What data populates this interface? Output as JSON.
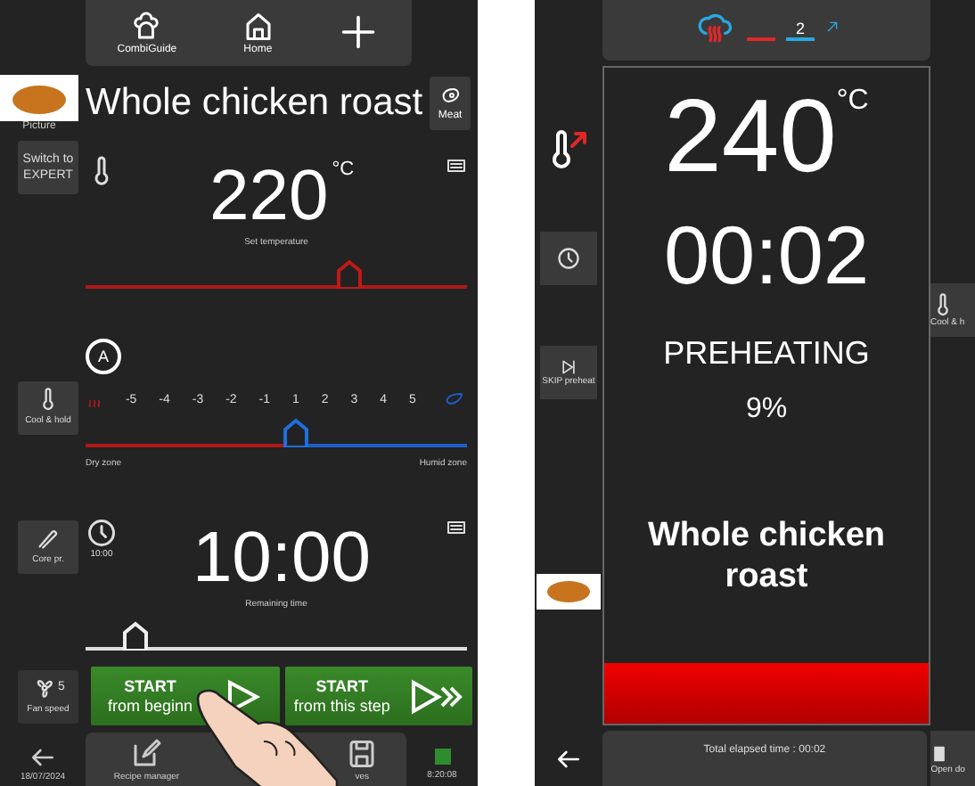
{
  "editor": {
    "top_bar": [
      {
        "kind": "guide",
        "label": "CombiGuide"
      },
      {
        "kind": "home",
        "label": "Home"
      },
      {
        "kind": "add"
      }
    ],
    "picture_label": "Picture",
    "title": "Whole chicken roast",
    "category_label": "Meat",
    "expert_button": "Switch to EXPERT",
    "temperature": {
      "value": "220",
      "unit": "°C",
      "caption": "Set temperature",
      "level": 0.69
    },
    "cool_hold_label": "Cool & hold",
    "humidity": {
      "icon_label": "A",
      "scale": [
        "-5",
        "-4",
        "-3",
        "-2",
        "-1",
        "1",
        "2",
        "3",
        "4",
        "5"
      ],
      "level": 0.55,
      "left_label": "Dry zone",
      "right_label": "Humid zone"
    },
    "core_probe_label": "Core pr.",
    "time": {
      "preset": "10:00",
      "value": "10:00",
      "caption": "Remaining time",
      "level": 0.13
    },
    "fan": {
      "label": "Fan speed",
      "value": "5"
    },
    "start_buttons": [
      {
        "kind": "beginning",
        "title": "START",
        "subtitle": "from beginn"
      },
      {
        "kind": "step",
        "title": "START",
        "subtitle": "from this step"
      }
    ],
    "footer": {
      "date": "18/07/2024",
      "actions": [
        {
          "kind": "edit",
          "label": "Recipe manager"
        },
        {
          "kind": "save",
          "label": "ves"
        }
      ],
      "time": "8:20:08"
    }
  },
  "cooking": {
    "mode_value": "2",
    "temperature": "240",
    "unit": "°C",
    "timer": "00:02",
    "status": "PREHEATING",
    "progress": "9%",
    "title": "Whole chicken roast",
    "skip_label": "SKIP preheat",
    "cool_label": "Cool & h",
    "elapsed": "Total elapsed time : 00:02",
    "door_label": "Open do"
  }
}
